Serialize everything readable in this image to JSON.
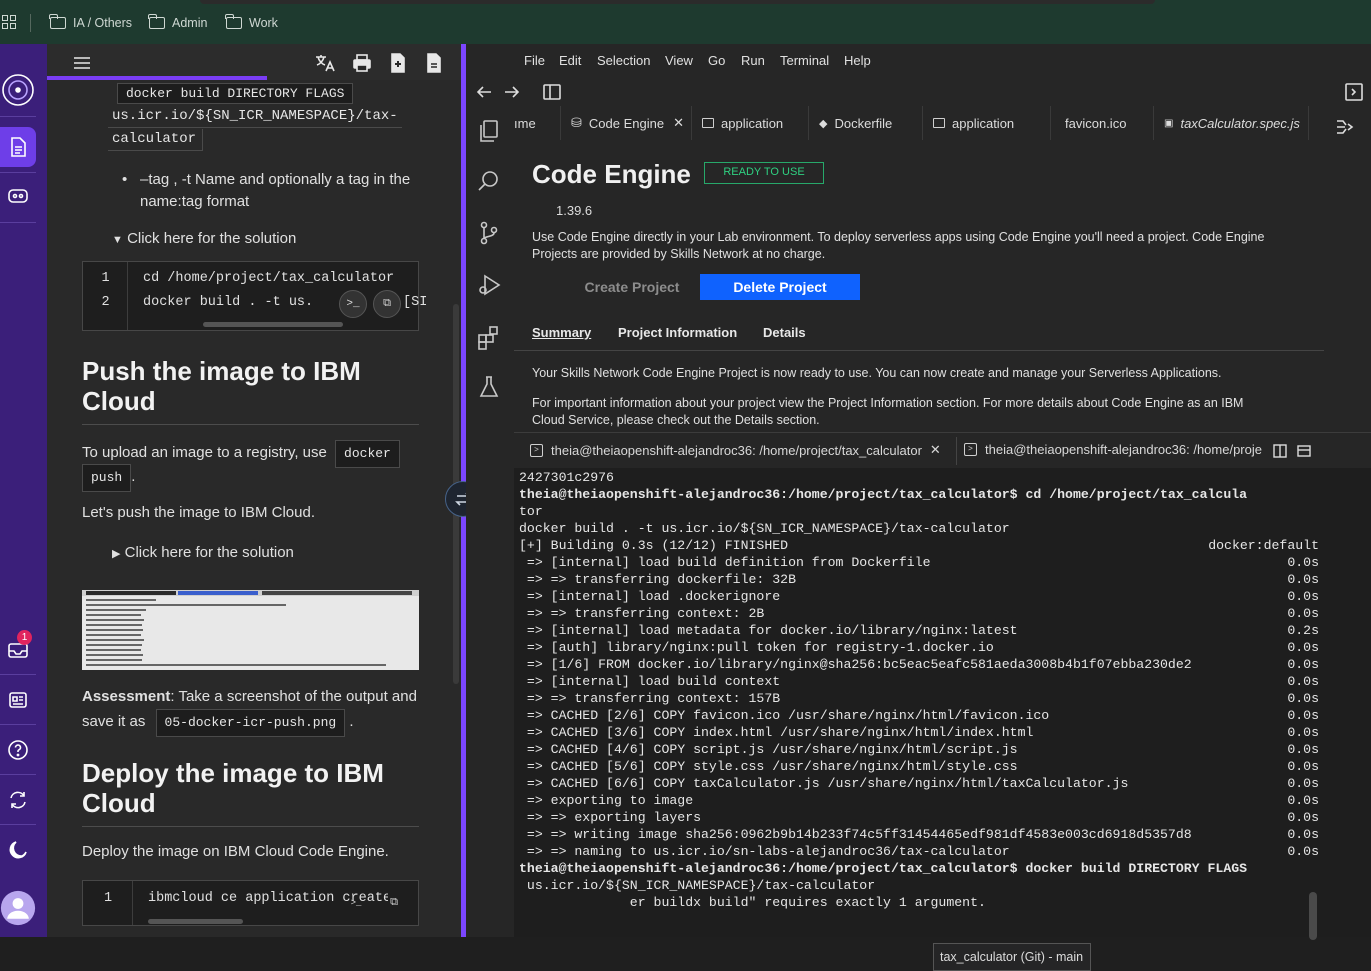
{
  "bookmarks": {
    "items": [
      {
        "label": "IA / Others"
      },
      {
        "label": "Admin"
      },
      {
        "label": "Work"
      }
    ]
  },
  "instructions": {
    "code_flags": "docker build DIRECTORY FLAGS",
    "code_uri_1": "us.icr.io/${SN_ICR_NAMESPACE}/tax-",
    "code_uri_2": "calculator",
    "bullet_line_1": "–tag , -t Name and optionally a tag in the",
    "bullet_line_2": "name:tag format",
    "solution_toggle_1": "Click here for the solution",
    "codeblock1": {
      "lines": [
        {
          "n": "1",
          "text": "cd /home/project/tax_calculator"
        },
        {
          "n": "2",
          "text": "docker build . -t us."
        }
      ],
      "tail": "[SI"
    },
    "push_heading_1": "Push the image to IBM",
    "push_heading_2": "Cloud",
    "upload_text": "To upload an image to a registry, use",
    "code_docker": "docker",
    "code_push": "push",
    "push_period": ".",
    "lets_push": "Let's push the image to IBM Cloud.",
    "solution_toggle_2": "Click here for the solution",
    "assessment_label": "Assessment",
    "assessment_text_1": ": Take a screenshot of the output and",
    "assessment_text_2": "save it as",
    "assessment_file": "05-docker-icr-push.png",
    "assessment_period": ".",
    "deploy_heading_1": "Deploy the image to IBM",
    "deploy_heading_2": "Cloud",
    "deploy_text": "Deploy the image on IBM Cloud Code Engine.",
    "codeblock2": {
      "lines": [
        {
          "n": "1",
          "text": "ibmcloud ce application create"
        }
      ]
    }
  },
  "rail": {
    "badge_count": "1"
  },
  "ide": {
    "menu": [
      "File",
      "Edit",
      "Selection",
      "View",
      "Go",
      "Run",
      "Terminal",
      "Help"
    ],
    "tabs": [
      {
        "label": "ıme"
      },
      {
        "label": "Code Engine"
      },
      {
        "label": "application"
      },
      {
        "label": "Dockerfile"
      },
      {
        "label": "application"
      },
      {
        "label": "favicon.ico"
      },
      {
        "label": "taxCalculator.spec.js"
      }
    ],
    "code_engine": {
      "title": "Code Engine",
      "status": "READY TO USE",
      "version": "1.39.6",
      "description_1": "Use Code Engine directly in your Lab environment. To deploy serverless apps using Code Engine you'll need a project. Code Engine",
      "description_2": "Projects are provided by Skills Network at no charge.",
      "create_label": "Create Project",
      "delete_label": "Delete Project",
      "subtabs": [
        "Summary",
        "Project Information",
        "Details"
      ],
      "summary_1": "Your Skills Network Code Engine Project is now ready to use. You can now create and manage your Serverless Applications.",
      "summary_2": "For important information about your project view the Project Information section. For more details about Code Engine as an IBM",
      "summary_3": "Cloud Service, please check out the Details section."
    },
    "terminal": {
      "tab1": "theia@theiaopenshift-alejandroc36: /home/project/tax_calculator",
      "tab2": "theia@theiaopenshift-alejandroc36: /home/proje",
      "lines": [
        {
          "left": "2427301c2976",
          "right": ""
        },
        {
          "left": "theia@theiaopenshift-alejandroc36:/home/project/tax_calculator$ cd /home/project/tax_calcula",
          "right": "",
          "bold": true
        },
        {
          "left": "tor",
          "right": ""
        },
        {
          "left": "docker build . -t us.icr.io/${SN_ICR_NAMESPACE}/tax-calculator",
          "right": ""
        },
        {
          "left": "[+] Building 0.3s (12/12) FINISHED",
          "right": "docker:default"
        },
        {
          "left": " => [internal] load build definition from Dockerfile",
          "right": "0.0s"
        },
        {
          "left": " => => transferring dockerfile: 32B",
          "right": "0.0s"
        },
        {
          "left": " => [internal] load .dockerignore",
          "right": "0.0s"
        },
        {
          "left": " => => transferring context: 2B",
          "right": "0.0s"
        },
        {
          "left": " => [internal] load metadata for docker.io/library/nginx:latest",
          "right": "0.2s"
        },
        {
          "left": " => [auth] library/nginx:pull token for registry-1.docker.io",
          "right": "0.0s"
        },
        {
          "left": " => [1/6] FROM docker.io/library/nginx@sha256:bc5eac5eafc581aeda3008b4b1f07ebba230de2",
          "right": "0.0s"
        },
        {
          "left": " => [internal] load build context",
          "right": "0.0s"
        },
        {
          "left": " => => transferring context: 157B",
          "right": "0.0s"
        },
        {
          "left": " => CACHED [2/6] COPY favicon.ico /usr/share/nginx/html/favicon.ico",
          "right": "0.0s"
        },
        {
          "left": " => CACHED [3/6] COPY index.html /usr/share/nginx/html/index.html",
          "right": "0.0s"
        },
        {
          "left": " => CACHED [4/6] COPY script.js /usr/share/nginx/html/script.js",
          "right": "0.0s"
        },
        {
          "left": " => CACHED [5/6] COPY style.css /usr/share/nginx/html/style.css",
          "right": "0.0s"
        },
        {
          "left": " => CACHED [6/6] COPY taxCalculator.js /usr/share/nginx/html/taxCalculator.js",
          "right": "0.0s"
        },
        {
          "left": " => exporting to image",
          "right": "0.0s"
        },
        {
          "left": " => => exporting layers",
          "right": "0.0s"
        },
        {
          "left": " => => writing image sha256:0962b9b14b233f74c5ff31454465edf981df4583e003cd6918d5357d8",
          "right": "0.0s"
        },
        {
          "left": " => => naming to us.icr.io/sn-labs-alejandroc36/tax-calculator",
          "right": "0.0s"
        },
        {
          "left": "theia@theiaopenshift-alejandroc36:/home/project/tax_calculator$ docker build DIRECTORY FLAGS",
          "right": "",
          "bold": true
        },
        {
          "left": " us.icr.io/${SN_ICR_NAMESPACE}/tax-calculator",
          "right": ""
        },
        {
          "left": "              er buildx build\" requires exactly 1 argument.",
          "right": ""
        }
      ]
    },
    "tooltip": "tax_calculator (Git) - main"
  }
}
